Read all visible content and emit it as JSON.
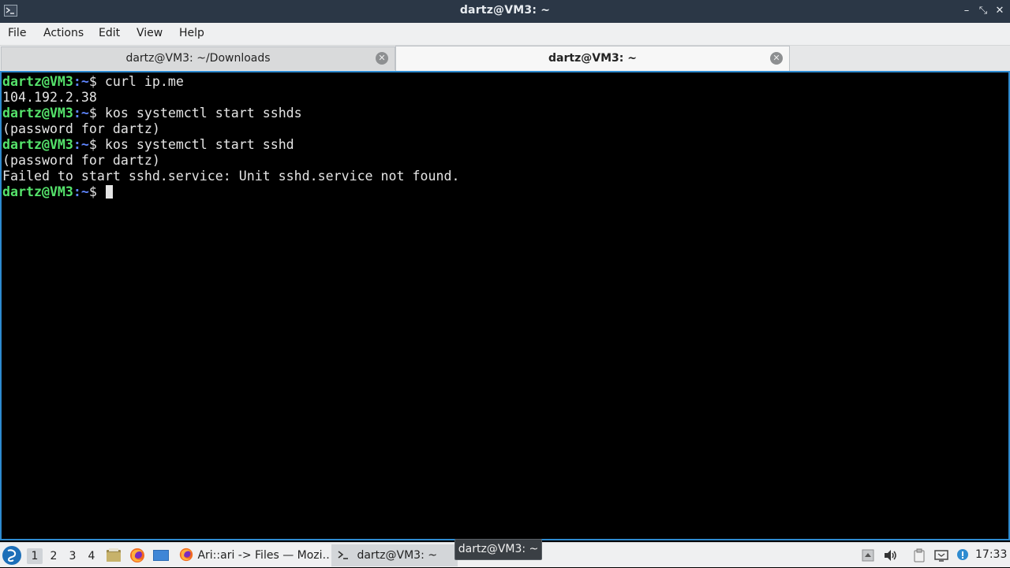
{
  "window": {
    "title": "dartz@VM3: ~",
    "controls": {
      "minimize": "–",
      "maximize": "⤡",
      "close": "✕"
    }
  },
  "menu": {
    "items": [
      "File",
      "Actions",
      "Edit",
      "View",
      "Help"
    ]
  },
  "tabs": [
    {
      "label": "dartz@VM3: ~/Downloads",
      "active": false
    },
    {
      "label": "dartz@VM3: ~",
      "active": true
    }
  ],
  "terminal": {
    "prompt": {
      "user_host": "dartz@VM3",
      "sep": ":",
      "path": "~",
      "symbol": "$ "
    },
    "lines": [
      {
        "type": "cmd",
        "text": "curl ip.me"
      },
      {
        "type": "out",
        "text": "104.192.2.38"
      },
      {
        "type": "cmd",
        "text": "kos systemctl start sshds"
      },
      {
        "type": "out",
        "text": "(password for dartz)"
      },
      {
        "type": "cmd",
        "text": "kos systemctl start sshd"
      },
      {
        "type": "out",
        "text": "(password for dartz)"
      },
      {
        "type": "out",
        "text": "Failed to start sshd.service: Unit sshd.service not found."
      },
      {
        "type": "cmd",
        "text": ""
      }
    ]
  },
  "taskbar": {
    "desktops": [
      "1",
      "2",
      "3",
      "4"
    ],
    "active_desktop": "1",
    "tasks": [
      {
        "label": "Ari::ari -> Files — Mozi…",
        "icon": "firefox-icon"
      },
      {
        "label": "dartz@VM3: ~",
        "icon": "terminal-icon",
        "active": true
      }
    ],
    "tooltip": "dartz@VM3: ~",
    "clock": "17:33"
  },
  "colors": {
    "titlebar": "#2b3746",
    "prompt_user": "#55e36b",
    "prompt_path": "#5f86ff",
    "terminal_border": "#2e8bd0"
  }
}
